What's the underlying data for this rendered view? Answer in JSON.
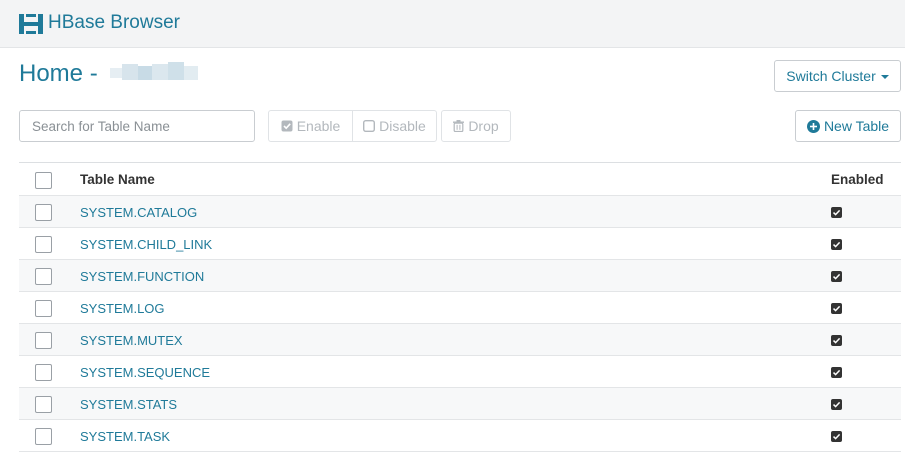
{
  "header": {
    "app_title": "HBase Browser",
    "logo_icon": "hbase-logo-icon"
  },
  "page": {
    "title_prefix": "Home - ",
    "cluster_name_blurred": true
  },
  "toolbar": {
    "switch_cluster_label": "Switch Cluster",
    "search_placeholder": "Search for Table Name",
    "enable_label": "Enable",
    "disable_label": "Disable",
    "drop_label": "Drop",
    "new_table_label": "New Table"
  },
  "table": {
    "columns": [
      "Table Name",
      "Enabled"
    ],
    "rows": [
      {
        "name": "SYSTEM.CATALOG",
        "enabled": true
      },
      {
        "name": "SYSTEM.CHILD_LINK",
        "enabled": true
      },
      {
        "name": "SYSTEM.FUNCTION",
        "enabled": true
      },
      {
        "name": "SYSTEM.LOG",
        "enabled": true
      },
      {
        "name": "SYSTEM.MUTEX",
        "enabled": true
      },
      {
        "name": "SYSTEM.SEQUENCE",
        "enabled": true
      },
      {
        "name": "SYSTEM.STATS",
        "enabled": true
      },
      {
        "name": "SYSTEM.TASK",
        "enabled": true
      }
    ]
  },
  "colors": {
    "accent": "#1f7a99",
    "topbar_bg": "#f3f4f5",
    "stripe": "#f7f8f9"
  }
}
